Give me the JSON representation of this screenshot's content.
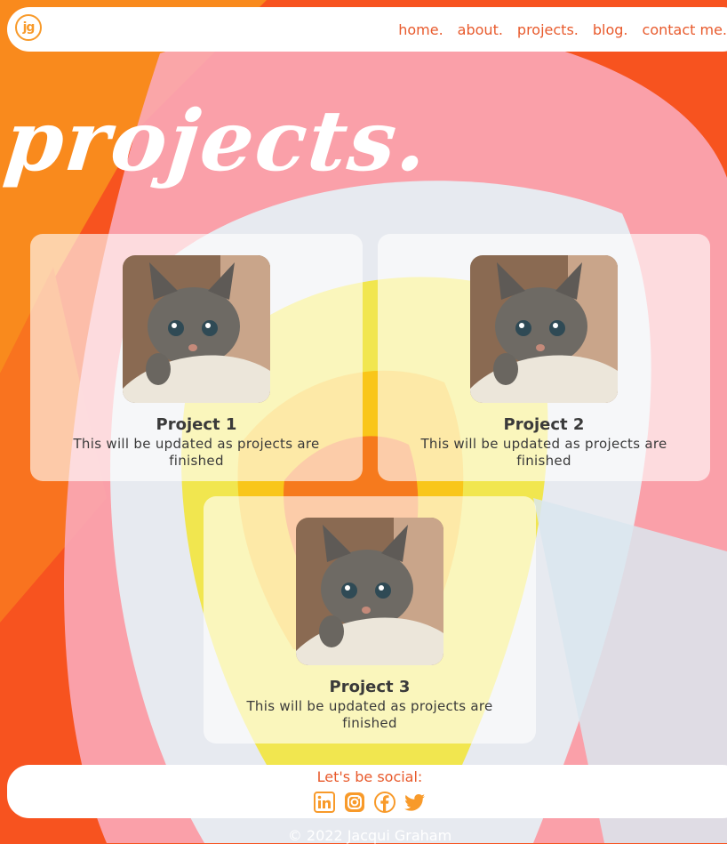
{
  "brand": {
    "logo_text": "jg",
    "color": "#f89a2a"
  },
  "nav": {
    "links": [
      "home.",
      "about.",
      "projects.",
      "blog.",
      "contact me."
    ],
    "color": "#e85a2c"
  },
  "page": {
    "title": "projects."
  },
  "projects": [
    {
      "title": "Project 1",
      "description": "This will be updated as projects are finished",
      "image": "kitten-photo"
    },
    {
      "title": "Project 2",
      "description": "This will be updated as projects are finished",
      "image": "kitten-photo"
    },
    {
      "title": "Project 3",
      "description": "This will be updated as projects are finished",
      "image": "kitten-photo"
    }
  ],
  "footer": {
    "social_label": "Let's be social:",
    "icons": [
      "linkedin-icon",
      "instagram-icon",
      "facebook-icon",
      "twitter-icon"
    ],
    "copyright": "© 2022 Jacqui Graham"
  },
  "colors": {
    "accent": "#e85a2c",
    "background": "#f7531f",
    "icon": "#f89a2a"
  }
}
